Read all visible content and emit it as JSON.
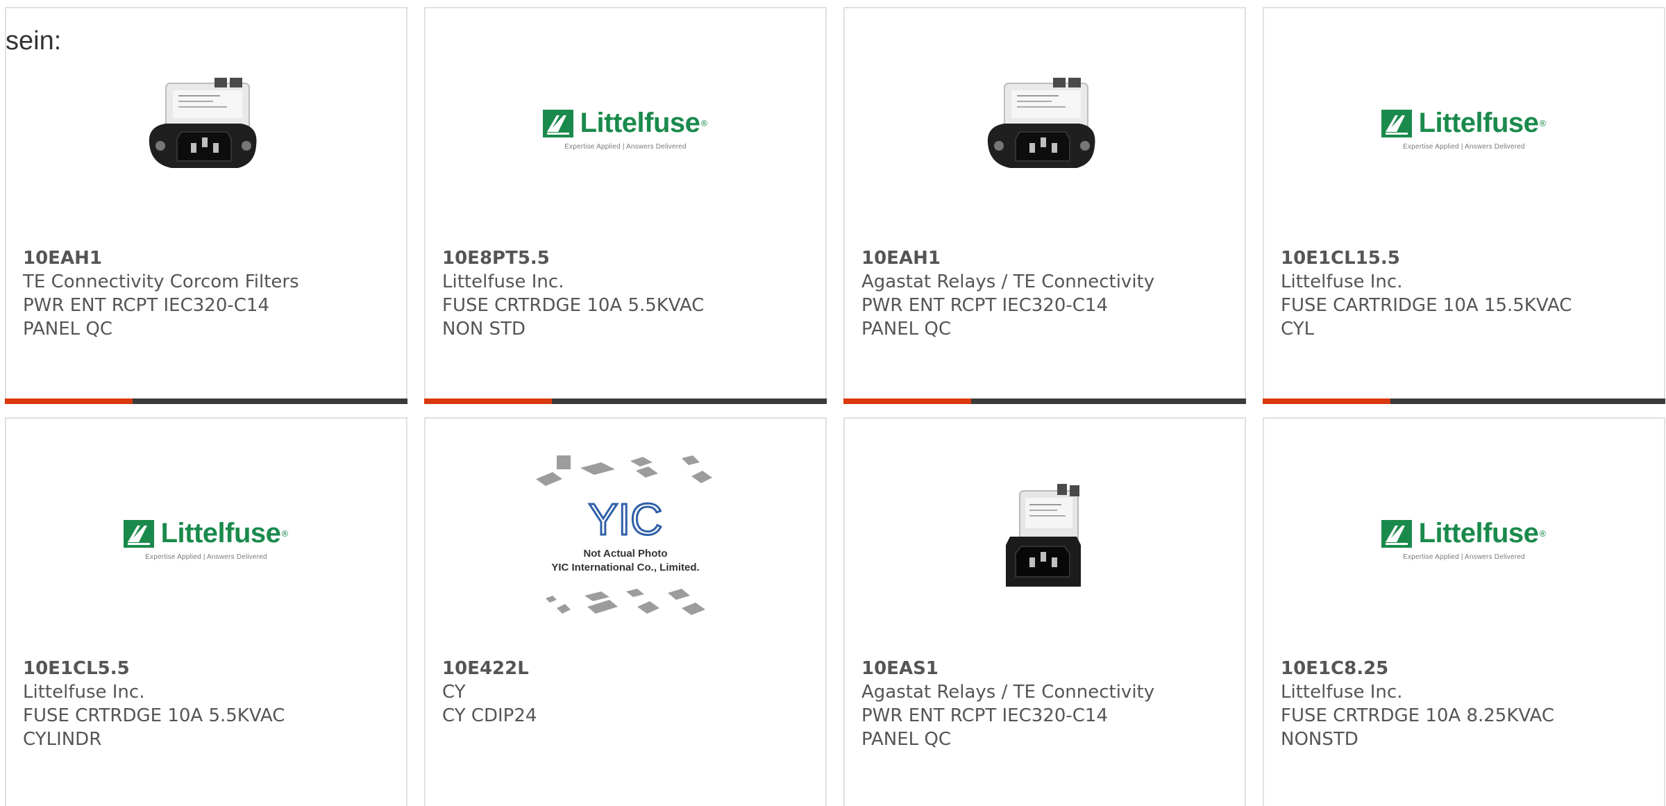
{
  "lead_text": "sein:",
  "logo": {
    "wordmark": "Littelfuse",
    "registered": "®",
    "tagline": "Expertise Applied | Answers Delivered"
  },
  "placeholder": {
    "mark": "YIC",
    "caption_line1": "Not Actual Photo",
    "caption_line2": "YIC International Co., Limited."
  },
  "colors": {
    "accent": "#d9390e",
    "bar": "#3b3b3b",
    "brand_green": "#1a8a4c"
  },
  "products": [
    {
      "part": "10EAH1",
      "manufacturer": "TE Connectivity Corcom Filters",
      "desc1": "PWR ENT RCPT IEC320-C14",
      "desc2": "PANEL QC",
      "image": "power-entry-module-image"
    },
    {
      "part": "10E8PT5.5",
      "manufacturer": "Littelfuse Inc.",
      "desc1": "FUSE CRTRDGE 10A 5.5KVAC",
      "desc2": "NON STD",
      "image": "littelfuse-logo"
    },
    {
      "part": "10EAH1",
      "manufacturer": "Agastat Relays / TE Connectivity",
      "desc1": "PWR ENT RCPT IEC320-C14",
      "desc2": "PANEL QC",
      "image": "power-entry-module-image"
    },
    {
      "part": "10E1CL15.5",
      "manufacturer": "Littelfuse Inc.",
      "desc1": "FUSE CARTRIDGE 10A 15.5KVAC",
      "desc2": "CYL",
      "image": "littelfuse-logo"
    },
    {
      "part": "10E1CL5.5",
      "manufacturer": "Littelfuse Inc.",
      "desc1": "FUSE CRTRDGE 10A 5.5KVAC",
      "desc2": "CYLINDR",
      "image": "littelfuse-logo"
    },
    {
      "part": "10E422L",
      "manufacturer": "CY",
      "desc1": "CY CDIP24",
      "desc2": "",
      "image": "not-actual-photo-placeholder"
    },
    {
      "part": "10EAS1",
      "manufacturer": "Agastat Relays / TE Connectivity",
      "desc1": "PWR ENT RCPT IEC320-C14",
      "desc2": "PANEL QC",
      "image": "power-entry-module-image"
    },
    {
      "part": "10E1C8.25",
      "manufacturer": "Littelfuse Inc.",
      "desc1": "FUSE CRTRDGE 10A 8.25KVAC",
      "desc2": "NONSTD",
      "image": "littelfuse-logo"
    }
  ]
}
